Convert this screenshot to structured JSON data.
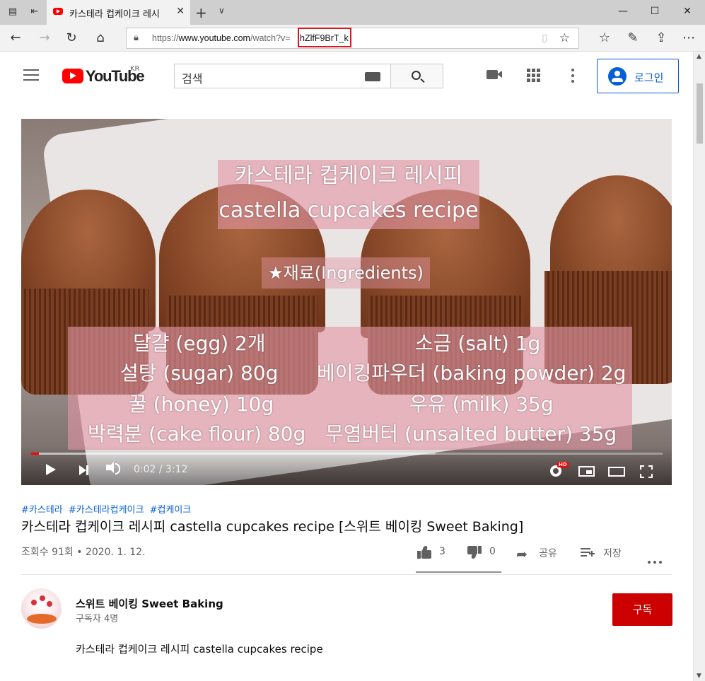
{
  "browser": {
    "tab_title": "카스테라 컵케이크 레시",
    "url_prefix": "https://",
    "url_domain": "www.youtube.com",
    "url_path": "/watch?v=",
    "url_highlight": "hZlfF9BrT_k"
  },
  "masthead": {
    "logo_text": "YouTube",
    "region": "KR",
    "search_placeholder": "검색",
    "signin_label": "로그인"
  },
  "player": {
    "overlay_title_ko": "카스테라 컵케이크 레시피",
    "overlay_title_en": "castella cupcakes recipe",
    "overlay_ingredients_heading": "★재료(Ingredients)",
    "ingredients_left": [
      "달걀 (egg) 2개",
      "설탕 (sugar) 80g",
      "꿀 (honey) 10g",
      "박력분 (cake flour) 80g"
    ],
    "ingredients_right": [
      "소금 (salt) 1g",
      "베이킹파우더 (baking powder) 2g",
      "우유 (milk) 35g",
      "무염버터 (unsalted butter) 35g"
    ],
    "time": "0:02 / 3:12",
    "played_fraction": 0.012,
    "loaded_fraction": 0.64,
    "hd_badge": "HD"
  },
  "video": {
    "hashtags": [
      "#카스테라",
      "#카스테라컵케이크",
      "#컵케이크"
    ],
    "title": "카스테라 컵케이크 레시피 castella cupcakes recipe [스위트 베이킹 Sweet Baking]",
    "views_date": "조회수 91회 • 2020. 1. 12.",
    "likes": "3",
    "dislikes": "0",
    "share_label": "공유",
    "save_label": "저장"
  },
  "channel": {
    "name": "스위트 베이킹 Sweet Baking",
    "subscribers": "구독자 4명",
    "subscribe_label": "구독",
    "description_line1": "카스테라 컵케이크 레시피 castella cupcakes recipe"
  }
}
